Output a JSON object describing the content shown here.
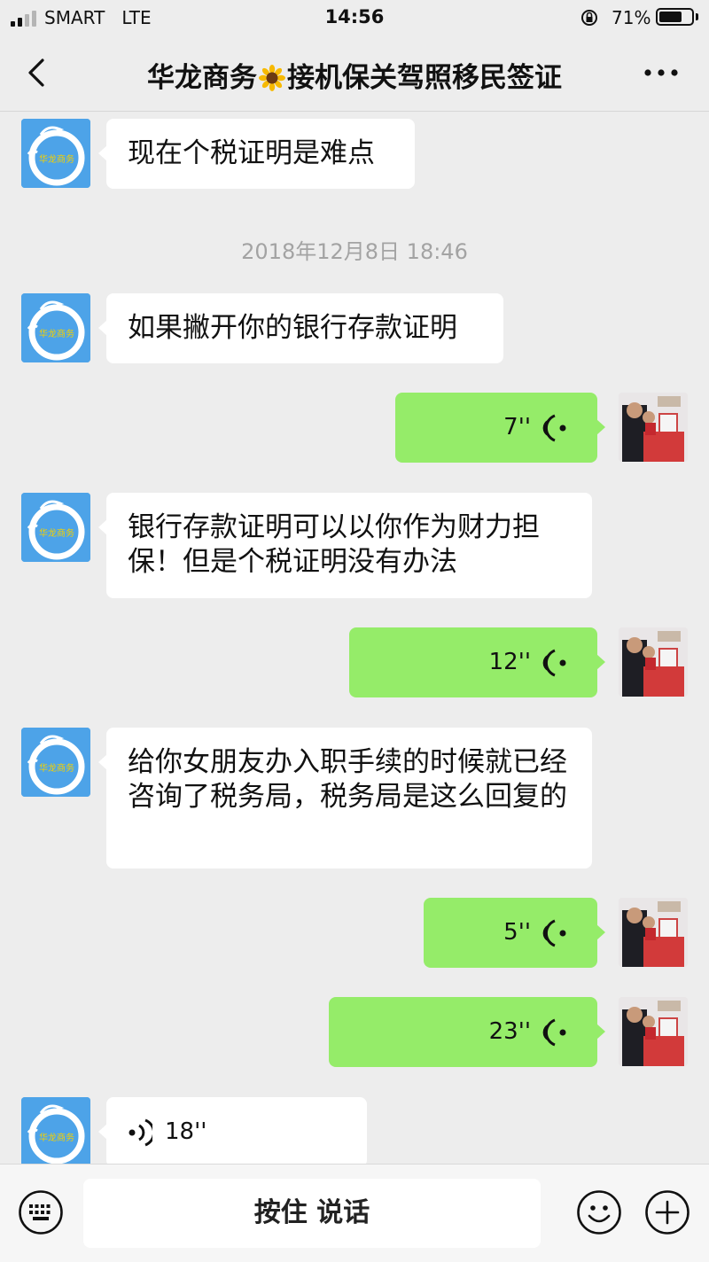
{
  "status_bar": {
    "carrier": "SMART",
    "network": "LTE",
    "time": "14:56",
    "battery_percent": "71%",
    "battery_level": 0.71,
    "signal_bars_active": 2,
    "signal_bars_total": 4
  },
  "nav": {
    "back_icon": "chevron-left",
    "title_before": "华龙商务",
    "title_icon": "sunflower",
    "title_after": "接机保关驾照移民签证",
    "more_icon": "ellipsis"
  },
  "messages": [
    {
      "from": "contact",
      "type": "text",
      "text": "现在个税证明是难点"
    },
    {
      "type": "timestamp",
      "text": "2018年12月8日 18:46"
    },
    {
      "from": "contact",
      "type": "text",
      "text": "如果撇开你的银行存款证明"
    },
    {
      "from": "me",
      "type": "voice",
      "duration": "7''"
    },
    {
      "from": "contact",
      "type": "text",
      "text": "银行存款证明可以以你作为财力担保！但是个税证明没有办法"
    },
    {
      "from": "me",
      "type": "voice",
      "duration": "12''"
    },
    {
      "from": "contact",
      "type": "text",
      "text": "给你女朋友办入职手续的时候就已经咨询了税务局，税务局是这么回复的"
    },
    {
      "from": "me",
      "type": "voice",
      "duration": "5''"
    },
    {
      "from": "me",
      "type": "voice",
      "duration": "23''"
    },
    {
      "from": "contact",
      "type": "voice",
      "duration": "18''"
    }
  ],
  "input_bar": {
    "keyboard_icon": "keyboard",
    "talk_label": "按住 说话",
    "emoji_icon": "smiley",
    "plus_icon": "plus"
  },
  "colors": {
    "background": "#ededed",
    "bubble_out": "#95ec69",
    "bubble_in": "#ffffff",
    "contact_avatar": "#4da3e8"
  }
}
